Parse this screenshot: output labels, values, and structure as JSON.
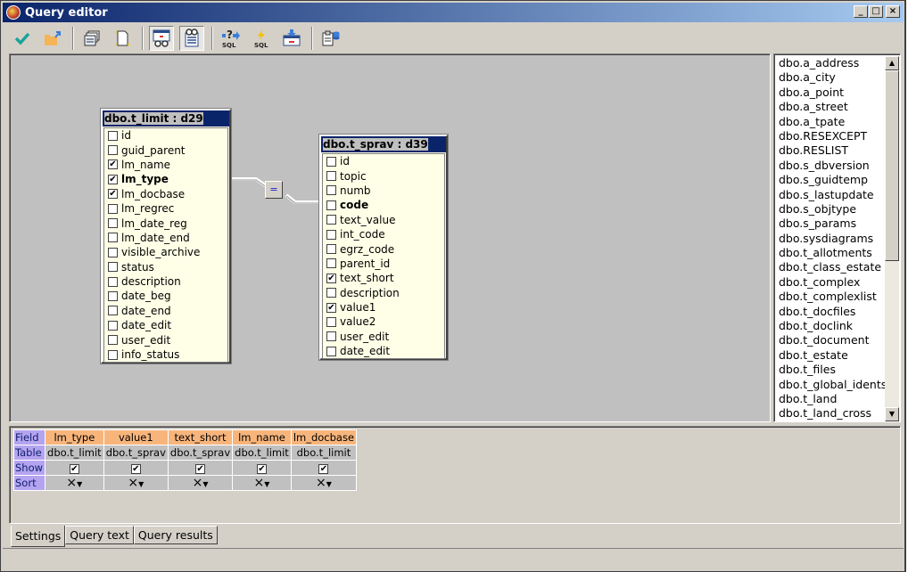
{
  "window": {
    "title": "Query editor",
    "controls": [
      "_",
      "□",
      "×"
    ]
  },
  "toolbar": {
    "buttons": [
      {
        "name": "apply-check",
        "icon": "check-icon"
      },
      {
        "name": "open-folder",
        "icon": "folder-icon"
      },
      {
        "name": "tables",
        "icon": "tables-icon"
      },
      {
        "name": "new-document",
        "icon": "new-page-icon"
      },
      {
        "name": "view-diagram",
        "icon": "glasses-diagram-icon",
        "pressed": true
      },
      {
        "name": "view-list",
        "icon": "glasses-list-icon",
        "pressed": true
      },
      {
        "name": "sql-help",
        "icon": "sql-question-icon",
        "label": "SQL"
      },
      {
        "name": "sql-execute",
        "icon": "sql-lightning-icon",
        "label": "SQL"
      },
      {
        "name": "import",
        "icon": "import-icon"
      },
      {
        "name": "database",
        "icon": "database-icon"
      }
    ]
  },
  "tables": [
    {
      "title": "dbo.t_limit : d29",
      "fields": [
        {
          "name": "id",
          "checked": false,
          "bold": false
        },
        {
          "name": "guid_parent",
          "checked": false,
          "bold": false
        },
        {
          "name": "lm_name",
          "checked": true,
          "bold": false
        },
        {
          "name": "lm_type",
          "checked": true,
          "bold": true
        },
        {
          "name": "lm_docbase",
          "checked": true,
          "bold": false
        },
        {
          "name": "lm_regrec",
          "checked": false,
          "bold": false
        },
        {
          "name": "lm_date_reg",
          "checked": false,
          "bold": false
        },
        {
          "name": "lm_date_end",
          "checked": false,
          "bold": false
        },
        {
          "name": "visible_archive",
          "checked": false,
          "bold": false
        },
        {
          "name": "status",
          "checked": false,
          "bold": false
        },
        {
          "name": "description",
          "checked": false,
          "bold": false
        },
        {
          "name": "date_beg",
          "checked": false,
          "bold": false
        },
        {
          "name": "date_end",
          "checked": false,
          "bold": false
        },
        {
          "name": "date_edit",
          "checked": false,
          "bold": false
        },
        {
          "name": "user_edit",
          "checked": false,
          "bold": false
        },
        {
          "name": "info_status",
          "checked": false,
          "bold": false
        }
      ]
    },
    {
      "title": "dbo.t_sprav : d39",
      "fields": [
        {
          "name": "id",
          "checked": false,
          "bold": false
        },
        {
          "name": "topic",
          "checked": false,
          "bold": false
        },
        {
          "name": "numb",
          "checked": false,
          "bold": false
        },
        {
          "name": "code",
          "checked": false,
          "bold": true
        },
        {
          "name": "text_value",
          "checked": false,
          "bold": false
        },
        {
          "name": "int_code",
          "checked": false,
          "bold": false
        },
        {
          "name": "egrz_code",
          "checked": false,
          "bold": false
        },
        {
          "name": "parent_id",
          "checked": false,
          "bold": false
        },
        {
          "name": "text_short",
          "checked": true,
          "bold": false
        },
        {
          "name": "description",
          "checked": false,
          "bold": false
        },
        {
          "name": "value1",
          "checked": true,
          "bold": false
        },
        {
          "name": "value2",
          "checked": false,
          "bold": false
        },
        {
          "name": "user_edit",
          "checked": false,
          "bold": false
        },
        {
          "name": "date_edit",
          "checked": false,
          "bold": false
        }
      ]
    }
  ],
  "join": {
    "operator": "="
  },
  "table_list": [
    "dbo.a_address",
    "dbo.a_city",
    "dbo.a_point",
    "dbo.a_street",
    "dbo.a_tpate",
    "dbo.RESEXCEPT",
    "dbo.RESLIST",
    "dbo.s_dbversion",
    "dbo.s_guidtemp",
    "dbo.s_lastupdate",
    "dbo.s_objtype",
    "dbo.s_params",
    "dbo.sysdiagrams",
    "dbo.t_allotments",
    "dbo.t_class_estate",
    "dbo.t_complex",
    "dbo.t_complexlist",
    "dbo.t_docfiles",
    "dbo.t_doclink",
    "dbo.t_document",
    "dbo.t_estate",
    "dbo.t_files",
    "dbo.t_global_idents",
    "dbo.t_land",
    "dbo.t_land_cross"
  ],
  "grid": {
    "row_headers": {
      "field": "Field",
      "table": "Table",
      "show": "Show",
      "sort": "Sort"
    },
    "columns": [
      {
        "field": "lm_type",
        "table": "dbo.t_limit",
        "show": true,
        "sort": "×"
      },
      {
        "field": "value1",
        "table": "dbo.t_sprav",
        "show": true,
        "sort": "×"
      },
      {
        "field": "text_short",
        "table": "dbo.t_sprav",
        "show": true,
        "sort": "×"
      },
      {
        "field": "lm_name",
        "table": "dbo.t_limit",
        "show": true,
        "sort": "×"
      },
      {
        "field": "lm_docbase",
        "table": "dbo.t_limit",
        "show": true,
        "sort": "×"
      }
    ]
  },
  "tabs": [
    {
      "label": "Settings",
      "active": true
    },
    {
      "label": "Query text",
      "active": false
    },
    {
      "label": "Query results",
      "active": false
    }
  ],
  "colors": {
    "title_start": "#0a246a",
    "title_end": "#a6caf0",
    "field_header": "#f7b57c",
    "row_header": "#b4a4f0",
    "table_bg": "#ffffe7"
  }
}
